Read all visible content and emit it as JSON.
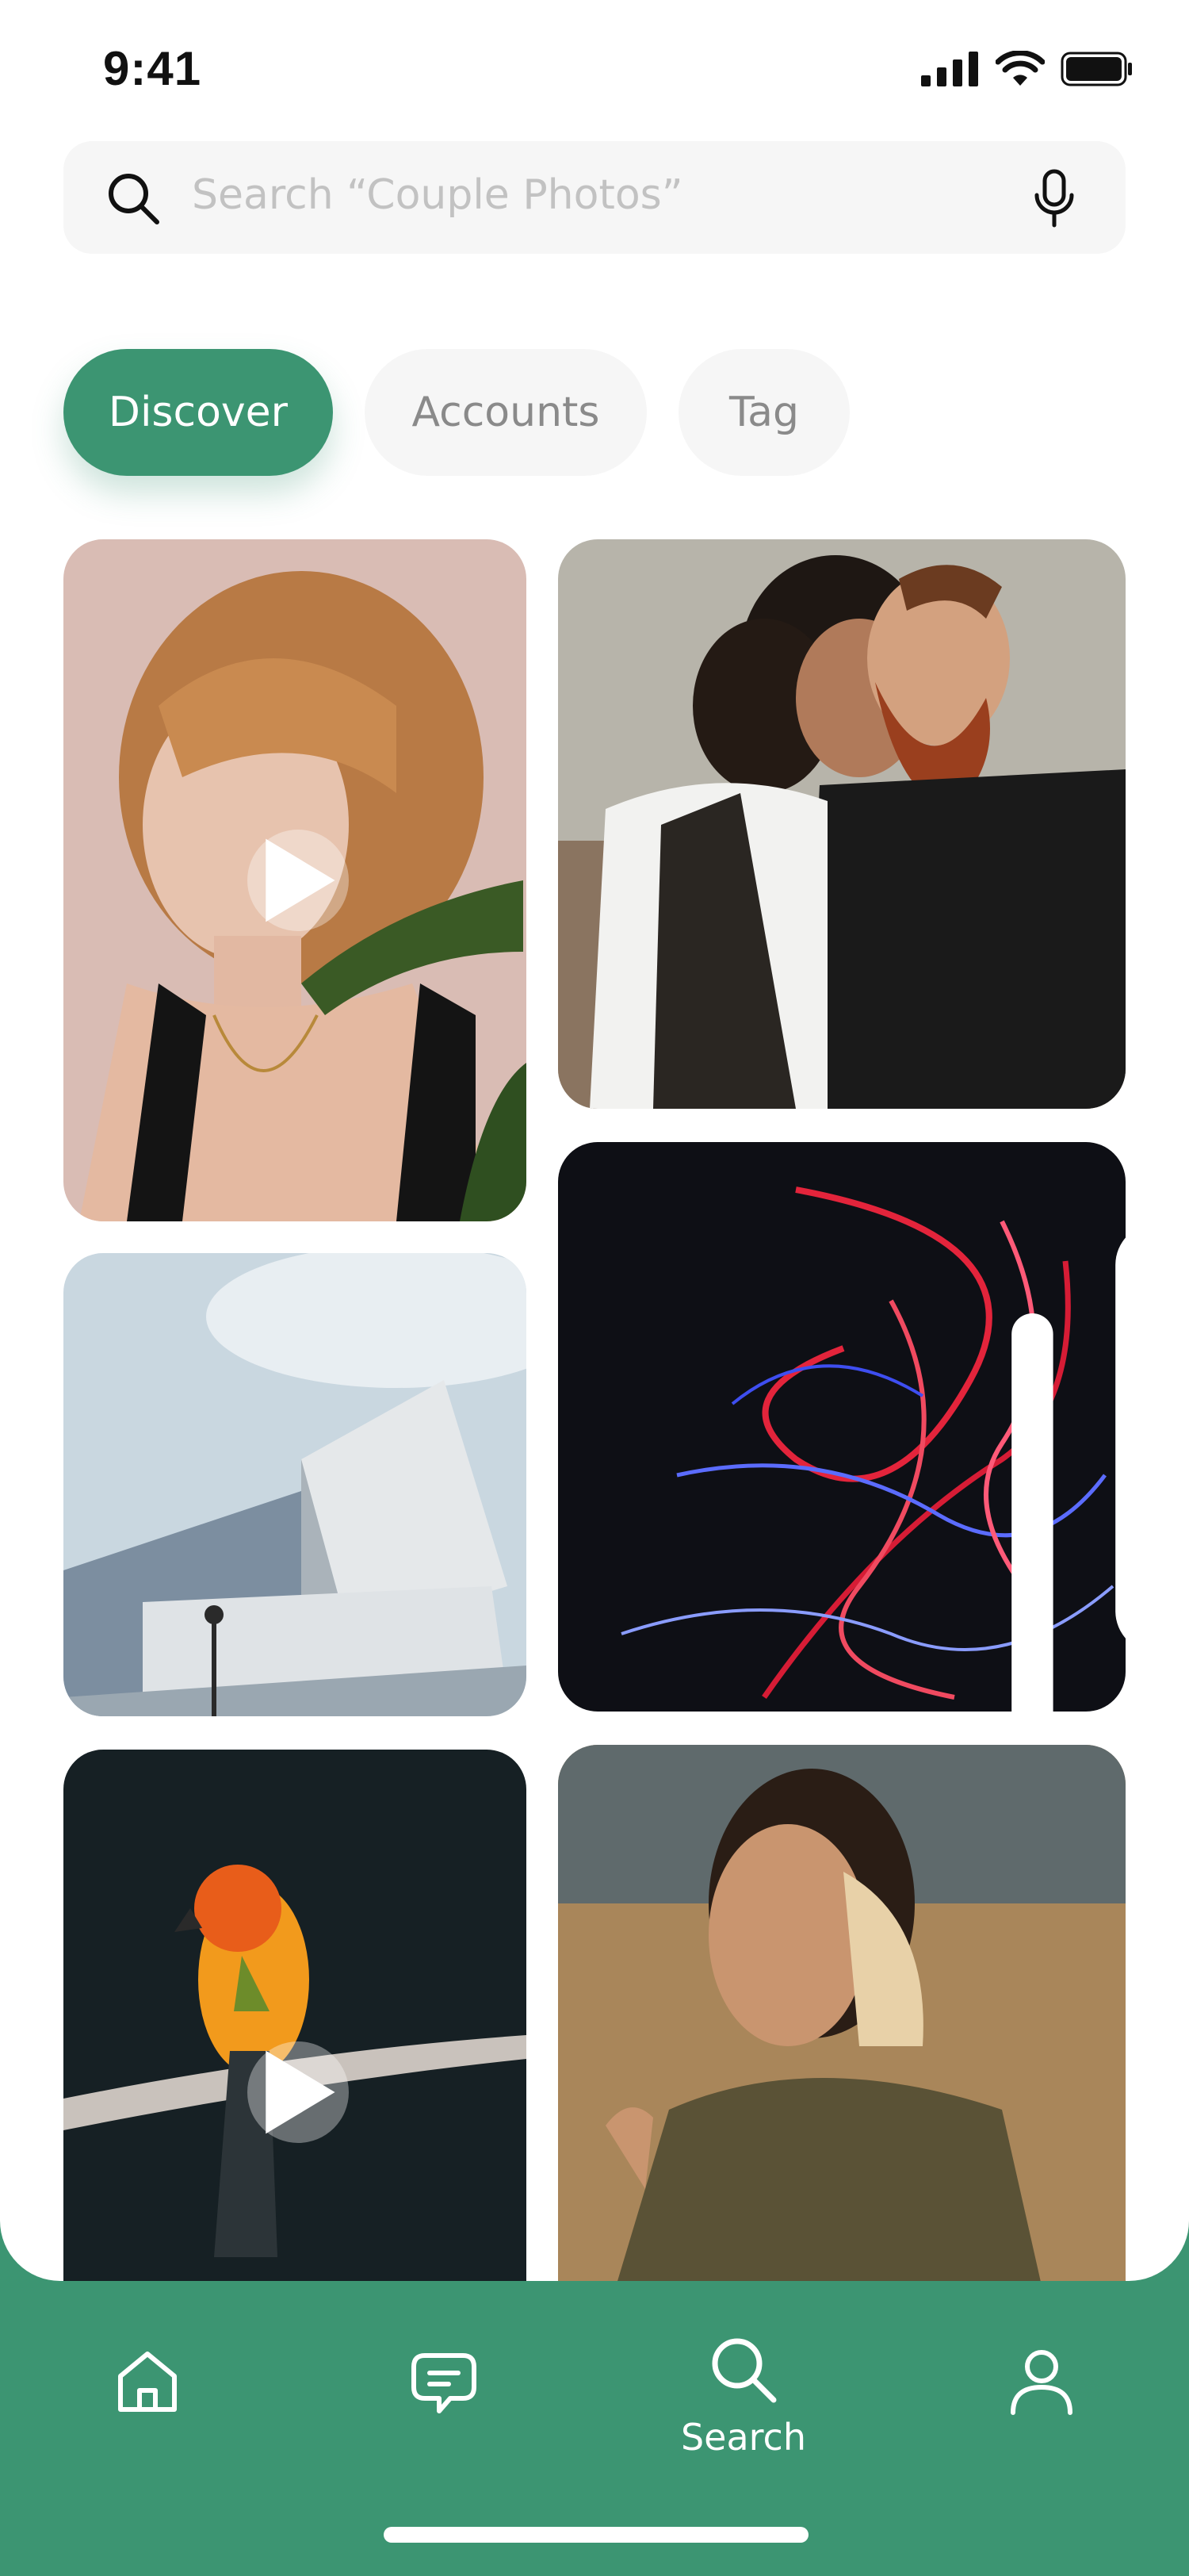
{
  "status_bar": {
    "time": "9:41"
  },
  "search": {
    "placeholder": "Search “Couple Photos”"
  },
  "tabs": [
    {
      "label": "Discover",
      "active": true
    },
    {
      "label": "Accounts",
      "active": false
    },
    {
      "label": "Tag",
      "active": false
    }
  ],
  "grid": [
    {
      "subject": "woman with bangs portrait",
      "type": "video"
    },
    {
      "subject": "couple embracing",
      "type": "photo"
    },
    {
      "subject": "modern glass building",
      "type": "photo"
    },
    {
      "subject": "red and blue light trails",
      "type": "carousel"
    },
    {
      "subject": "parrot on branch",
      "type": "video"
    },
    {
      "subject": "woman in olive jacket",
      "type": "photo"
    }
  ],
  "bottom_nav": {
    "items": [
      {
        "icon": "home-icon"
      },
      {
        "icon": "chat-icon"
      },
      {
        "icon": "search-icon",
        "label": "Search",
        "active": true
      },
      {
        "icon": "profile-icon"
      }
    ]
  },
  "colors": {
    "accent": "#3c9572",
    "pill_bg": "#f6f6f6",
    "placeholder": "#c2c2c2"
  }
}
